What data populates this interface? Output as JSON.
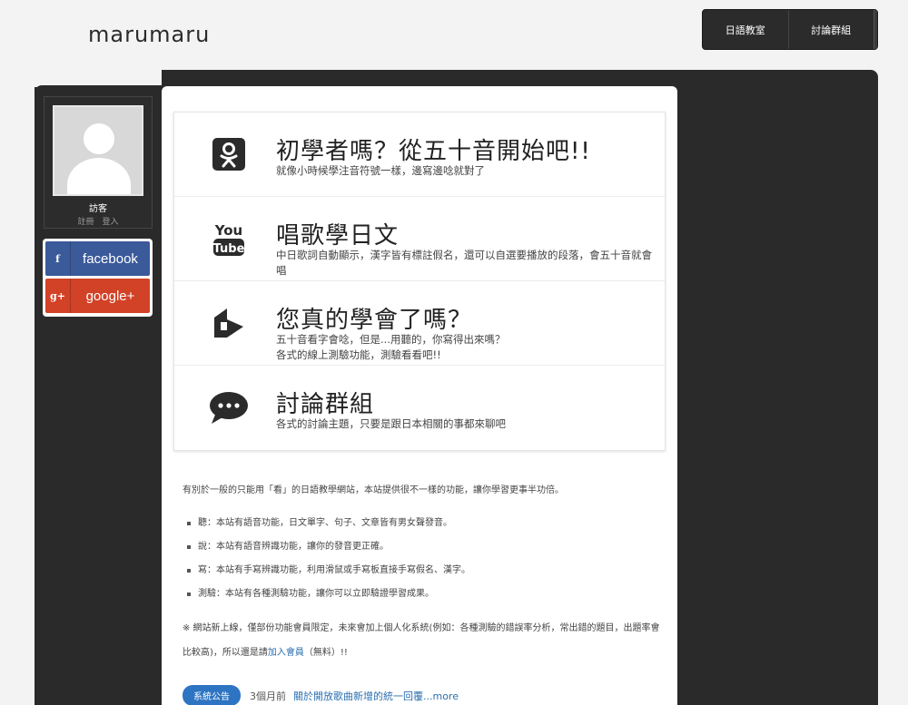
{
  "logo": "marumaru",
  "topnav": [
    {
      "label": "日語教室"
    },
    {
      "label": "討論群組"
    }
  ],
  "profile": {
    "username": "訪客",
    "register": "註冊",
    "login": "登入"
  },
  "social": {
    "facebook": {
      "icon": "f",
      "label": "facebook"
    },
    "google": {
      "icon": "g+",
      "label": "google+"
    }
  },
  "features": [
    {
      "icon": "odnoklassniki-icon",
      "title": "初學者嗎？從五十音開始吧!!",
      "desc": "就像小時候學注音符號一樣，邊寫邊唸就對了"
    },
    {
      "icon": "youtube-icon",
      "title": "唱歌學日文",
      "desc": "中日歌詞自動顯示，漢字皆有標註假名，還可以自選要播放的段落，會五十音就會唱"
    },
    {
      "icon": "quiz-icon",
      "title": "您真的學會了嗎？",
      "desc": "五十音看字會唸，但是...用聽的，你寫得出來嗎？\n各式的線上測驗功能，測驗看看吧!!"
    },
    {
      "icon": "chat-bubble-icon",
      "title": "討論群組",
      "desc": "各式的討論主題，只要是跟日本相關的事都來聊吧"
    }
  ],
  "youtube_text": {
    "top": "You",
    "bottom": "Tube"
  },
  "intro": "有別於一般的只能用「看」的日語教學網站，本站提供很不一樣的功能，讓你學習更事半功倍。",
  "bullets": [
    "聽：本站有語音功能，日文單字、句子、文章皆有男女聲發音。",
    "說：本站有語音辨識功能，讓你的發音更正確。",
    "寫：本站有手寫辨識功能，利用滑鼠或手寫板直接手寫假名、漢字。",
    "測驗：本站有各種測驗功能，讓你可以立即驗證學習成果。"
  ],
  "note": {
    "before": "※ 網站新上線，僅部份功能會員限定，未來會加上個人化系統(例如：各種測驗的錯誤率分析，常出錯的題目，出題率會比較高)，所以還是請",
    "link": "加入會員",
    "after": "（無料）!!"
  },
  "news": {
    "badge": "系統公告",
    "ago": "3個月前",
    "link": "關於開放歌曲新增的統一回覆...more"
  },
  "colors": {
    "dark": "#2a2a2a",
    "facebook": "#3b5a9a",
    "google": "#d24227",
    "link": "#2a6fb0"
  }
}
